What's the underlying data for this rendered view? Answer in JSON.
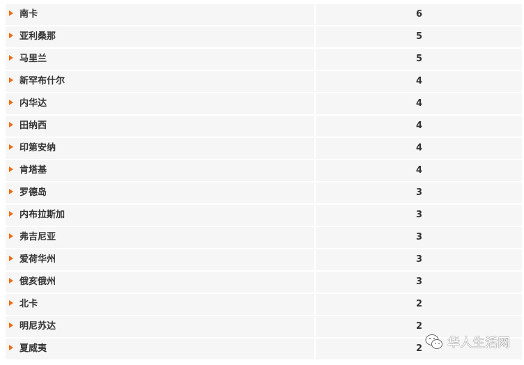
{
  "rows": [
    {
      "name": "南卡",
      "value": "6"
    },
    {
      "name": "亚利桑那",
      "value": "5"
    },
    {
      "name": "马里兰",
      "value": "5"
    },
    {
      "name": "新罕布什尔",
      "value": "4"
    },
    {
      "name": "内华达",
      "value": "4"
    },
    {
      "name": "田纳西",
      "value": "4"
    },
    {
      "name": "印第安纳",
      "value": "4"
    },
    {
      "name": "肯塔基",
      "value": "4"
    },
    {
      "name": "罗德岛",
      "value": "3"
    },
    {
      "name": "内布拉斯加",
      "value": "3"
    },
    {
      "name": "弗吉尼亚",
      "value": "3"
    },
    {
      "name": "爱荷华州",
      "value": "3"
    },
    {
      "name": "俄亥俄州",
      "value": "3"
    },
    {
      "name": "北卡",
      "value": "2"
    },
    {
      "name": "明尼苏达",
      "value": "2"
    },
    {
      "name": "夏威夷",
      "value": "2"
    }
  ],
  "watermark": {
    "text": "华人生活网",
    "icon": "wechat-icon"
  },
  "colors": {
    "accent": "#f26b0f",
    "row_bg": "#f6f6f6"
  }
}
